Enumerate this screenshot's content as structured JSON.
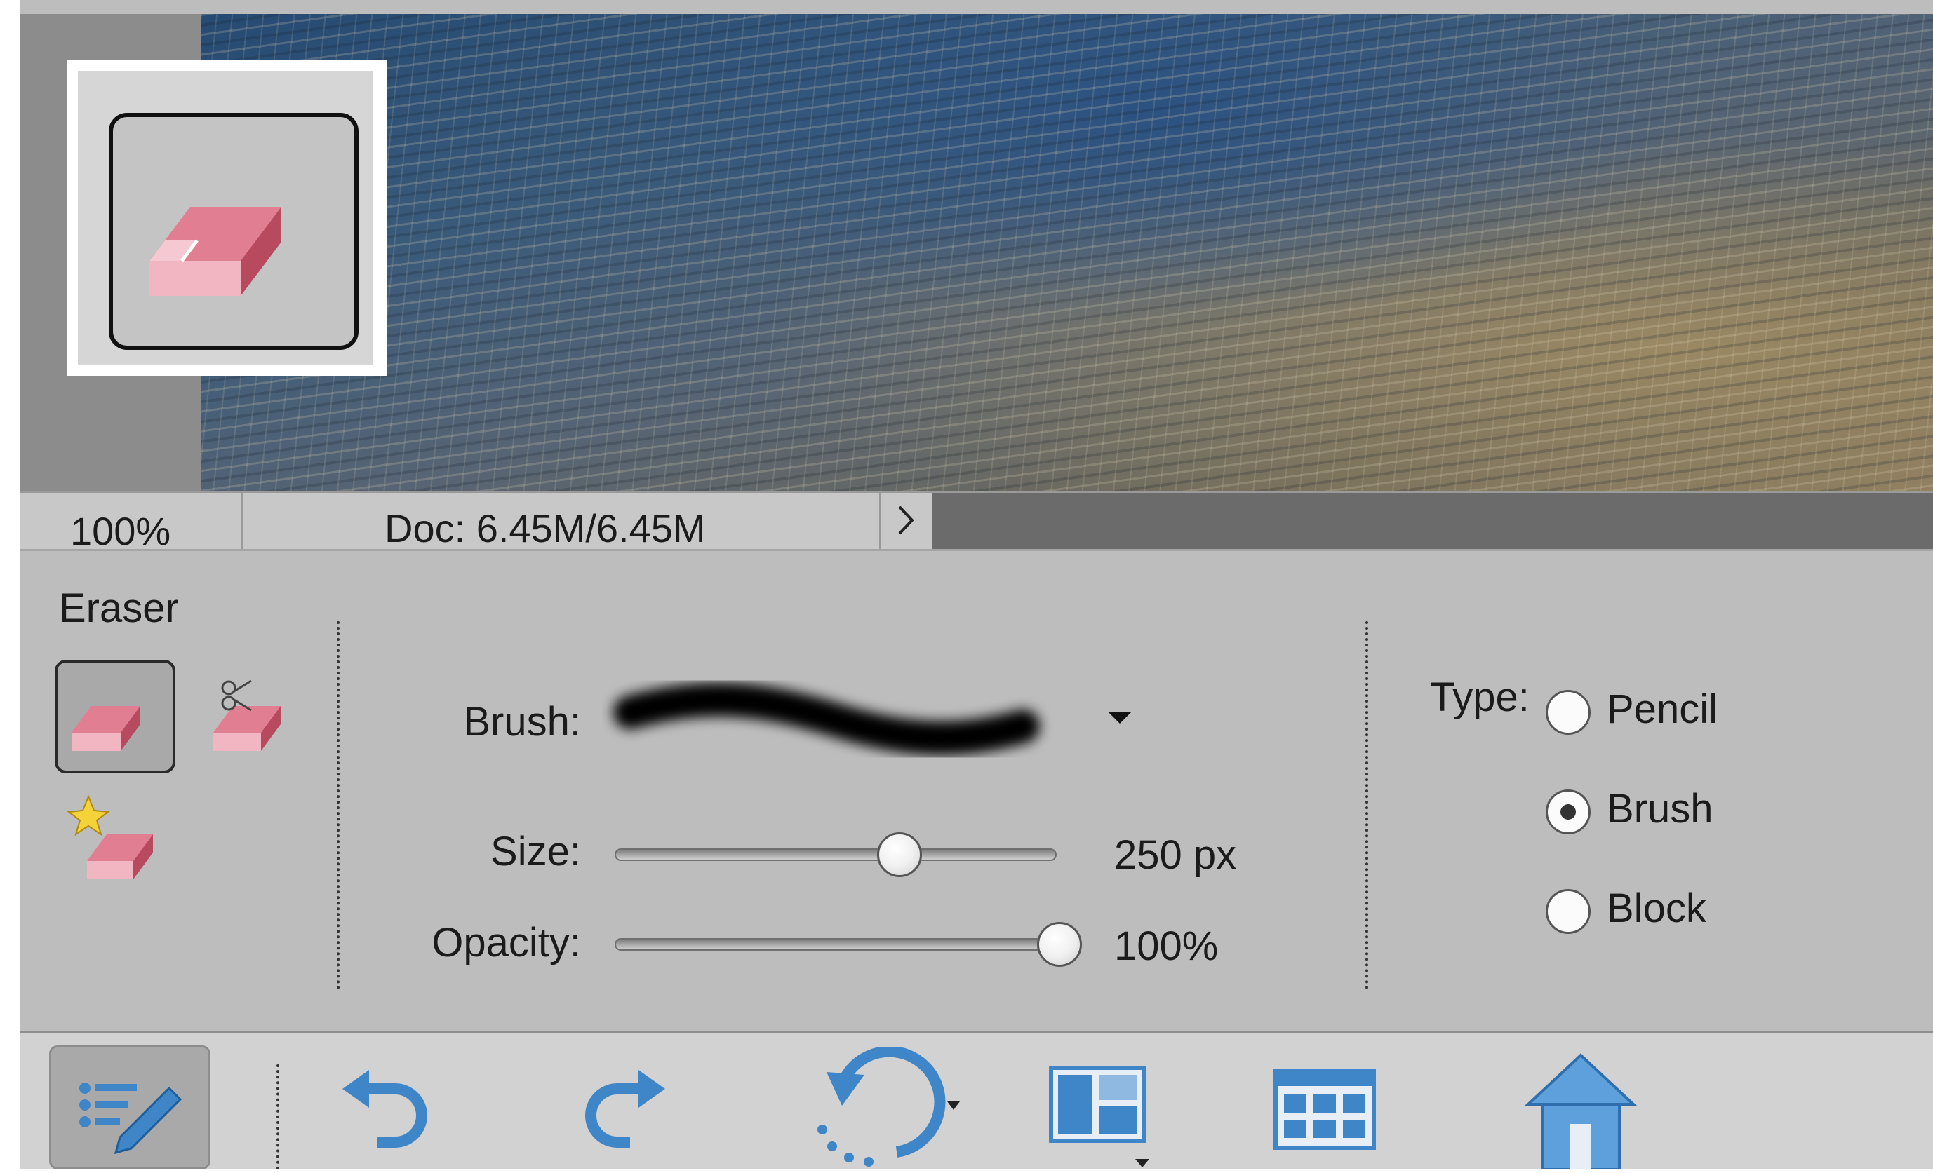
{
  "status": {
    "zoom": "100%",
    "doc": "Doc: 6.45M/6.45M"
  },
  "tool_options": {
    "tool_name": "Eraser",
    "brush_label": "Brush:",
    "size_label": "Size:",
    "size_value": "250 px",
    "size_fraction": 0.64,
    "opacity_label": "Opacity:",
    "opacity_value": "100%",
    "opacity_fraction": 1.0,
    "type_label": "Type:",
    "type_options": [
      "Pencil",
      "Brush",
      "Block"
    ],
    "type_selected": "Brush"
  },
  "icons": {
    "tool_preview": "eraser-icon",
    "variants": [
      "eraser-icon",
      "background-eraser-icon",
      "magic-eraser-icon"
    ],
    "taskbar": [
      "tool-options-icon",
      "undo-icon",
      "redo-icon",
      "rotate-icon",
      "layout-icon",
      "organizer-icon",
      "home-icon"
    ]
  },
  "colors": {
    "eraser_pink": "#e07a8c",
    "accent_blue": "#3f86c8"
  }
}
